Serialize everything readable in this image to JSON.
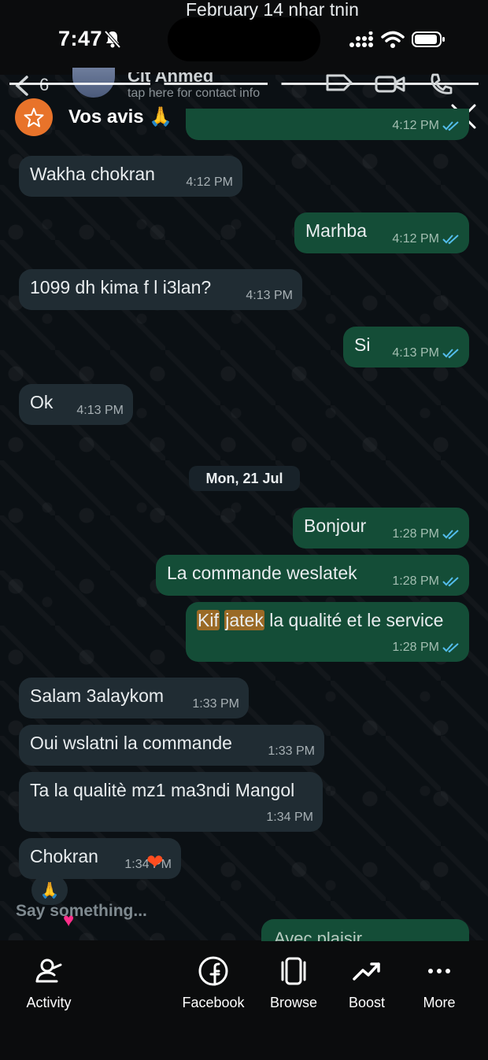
{
  "status_bar": {
    "time": "7:47"
  },
  "chat_header": {
    "back_count": "6",
    "contact_name": "Cit Ahmed",
    "contact_sub": "tap here for contact info"
  },
  "promo": {
    "title": "Vos avis 🙏",
    "accent": "#e8732a"
  },
  "messages": [
    {
      "dir": "out",
      "text": "February 14 nhar tnin",
      "time": "4:12 PM"
    },
    {
      "dir": "in",
      "text": "Wakha chokran",
      "time": "4:12 PM"
    },
    {
      "dir": "out",
      "text": "Marhba",
      "time": "4:12 PM"
    },
    {
      "dir": "in",
      "text": "1099 dh kima f l i3lan?",
      "time": "4:13 PM"
    },
    {
      "dir": "out",
      "text": "Si",
      "time": "4:13 PM"
    },
    {
      "dir": "in",
      "text": "Ok",
      "time": "4:13 PM"
    },
    {
      "dir": "out",
      "text": "Bonjour",
      "time": "1:28 PM"
    },
    {
      "dir": "out",
      "text": "La commande weslatek",
      "time": "1:28 PM"
    },
    {
      "dir": "out",
      "text_parts": [
        "Kif",
        "jatek",
        "la qualité et le service"
      ],
      "time": "1:28 PM"
    },
    {
      "dir": "in",
      "text": "Salam 3alaykom",
      "time": "1:33 PM"
    },
    {
      "dir": "in",
      "text": "Oui wslatni la commande",
      "time": "1:33 PM"
    },
    {
      "dir": "in",
      "text": "Ta la qualitè mz1 ma3ndi Mangol",
      "time": "1:34 PM"
    },
    {
      "dir": "in",
      "text": "Chokran",
      "time": "1:34 PM"
    },
    {
      "dir": "out",
      "text": "Avec plaisir",
      "time": ""
    }
  ],
  "date_chip": "Mon, 21 Jul",
  "reactions": {
    "pray": "🙏",
    "heart": "❤"
  },
  "comment_box": {
    "placeholder": "Say something..."
  },
  "bottom_nav": [
    {
      "label": "Activity",
      "icon": "activity-icon"
    },
    {
      "label": "Facebook",
      "icon": "facebook-icon"
    },
    {
      "label": "Browse",
      "icon": "browse-icon"
    },
    {
      "label": "Boost",
      "icon": "boost-icon"
    },
    {
      "label": "More",
      "icon": "more-icon"
    }
  ],
  "colors": {
    "incoming_bubble": "#202c33",
    "outgoing_bubble": "#144d37",
    "read_tick": "#53bdeb",
    "highlight": "#9a6a26"
  }
}
